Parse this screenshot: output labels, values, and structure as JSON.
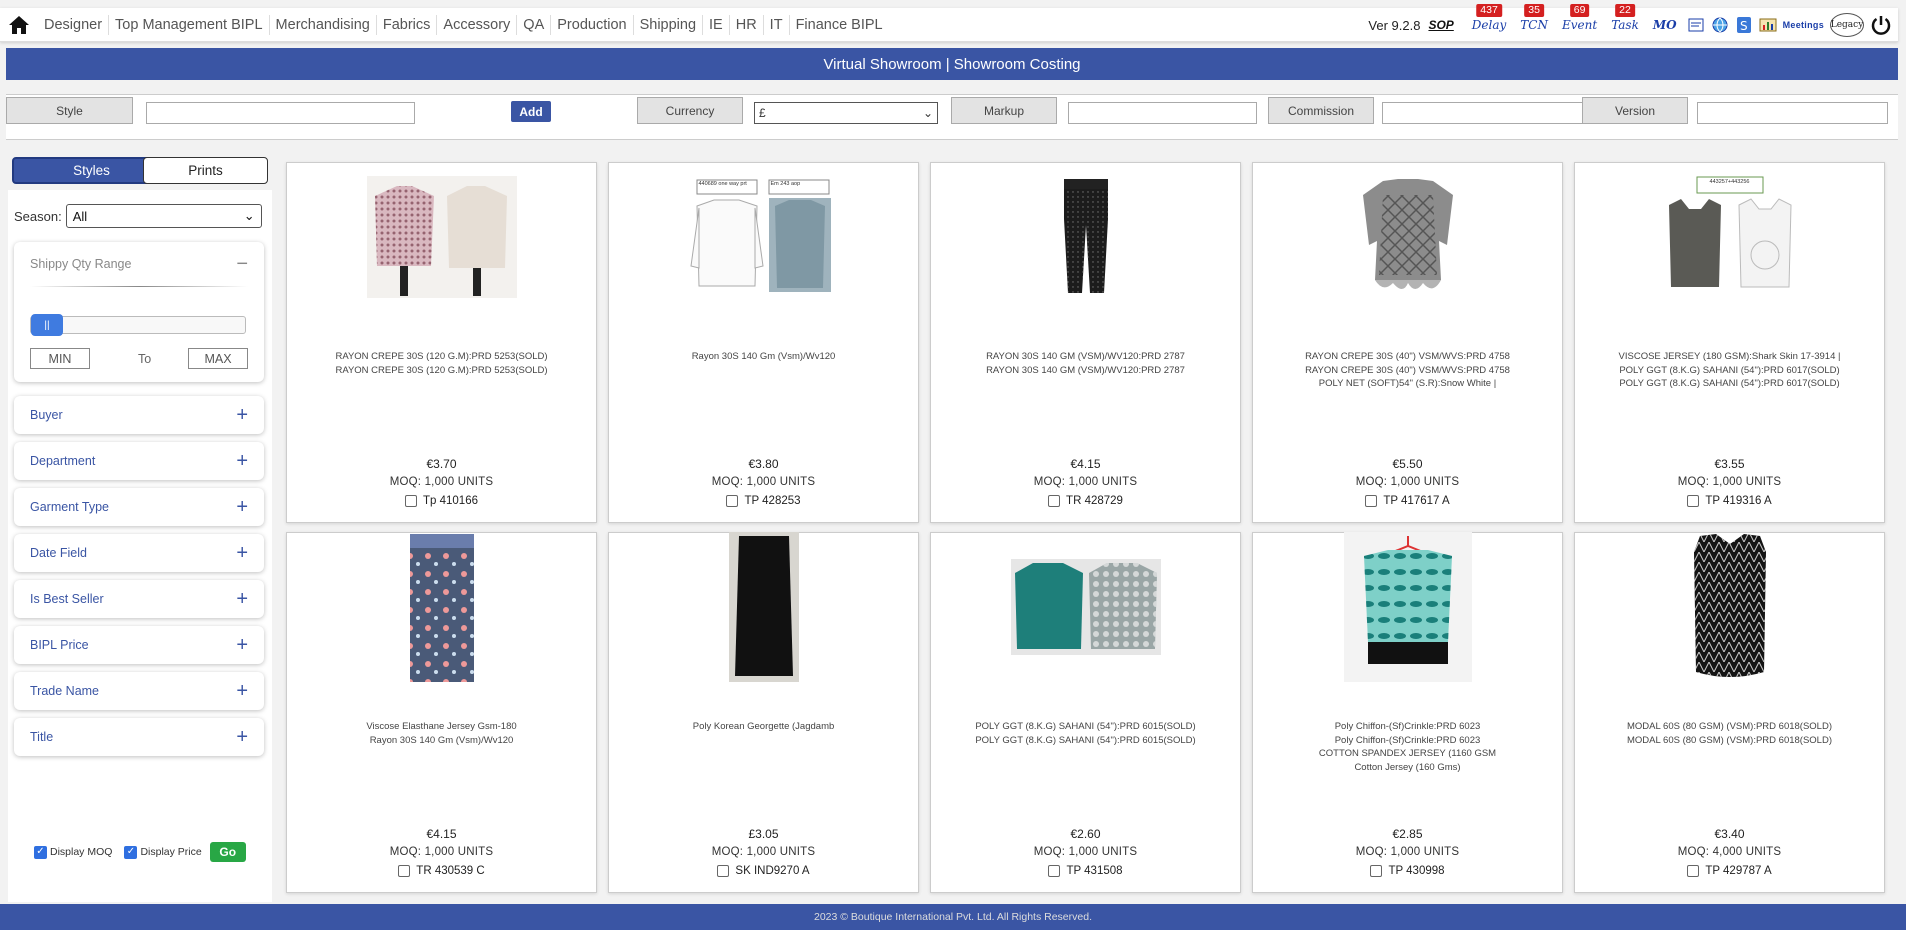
{
  "nav": {
    "menu": [
      "Designer",
      "Top Management BIPL",
      "Merchandising",
      "Fabrics",
      "Accessory",
      "QA",
      "Production",
      "Shipping",
      "IE",
      "HR",
      "IT",
      "Finance BIPL"
    ],
    "version": "Ver 9.2.8",
    "sop": "SOP",
    "delay": {
      "label": "Delay",
      "count": "437"
    },
    "tcn": {
      "label": "TCN",
      "count": "35"
    },
    "event": {
      "label": "Event",
      "count": "69"
    },
    "task": {
      "label": "Task",
      "count": "22"
    },
    "mo": "MO",
    "meetings": "Meetings",
    "legacy": "Legacy"
  },
  "title": "Virtual Showroom | Showroom Costing",
  "filters": {
    "style_label": "Style",
    "style_value": "",
    "add_label": "Add",
    "currency_label": "Currency",
    "currency_value": "£",
    "markup_label": "Markup",
    "markup_value": "",
    "commission_label": "Commission",
    "commission_value": "",
    "version_label": "Version",
    "version_value": ""
  },
  "sidebar": {
    "tab_styles": "Styles",
    "tab_prints": "Prints",
    "season_label": "Season:",
    "season_value": "All",
    "qty_title": "Shippy Qty Range",
    "qty_handle": "||",
    "min_label": "MIN",
    "to_label": "To",
    "max_label": "MAX",
    "panels": [
      "Buyer",
      "Department",
      "Garment Type",
      "Date Field",
      "Is Best Seller",
      "BIPL Price",
      "Trade Name",
      "Title"
    ],
    "display_moq": "Display MOQ",
    "display_price": "Display Price",
    "go": "Go"
  },
  "cards": [
    {
      "desc": [
        "RAYON CREPE 30S (120 G.M):PRD 5253(SOLD)",
        "RAYON CREPE 30S (120 G.M):PRD 5253(SOLD)"
      ],
      "price": "€3.70",
      "moq": "MOQ: 1,000 UNITS",
      "code": "Tp 410166",
      "img": "two-tops"
    },
    {
      "desc": [
        "Rayon 30S 140 Gm (Vsm)/Wv120"
      ],
      "price": "€3.80",
      "moq": "MOQ: 1,000 UNITS",
      "code": "TP 428253",
      "img": "sketch-tops",
      "tags": [
        "440689 one way prt",
        "Em 243 aop"
      ]
    },
    {
      "desc": [
        "RAYON 30S 140 GM (VSM)/WV120:PRD 2787",
        "RAYON 30S 140 GM (VSM)/WV120:PRD 2787"
      ],
      "price": "€4.15",
      "moq": "MOQ: 1,000 UNITS",
      "code": "TR 428729",
      "img": "trousers"
    },
    {
      "desc": [
        "RAYON CREPE 30S (40\") VSM/WVS:PRD 4758",
        "RAYON CREPE 30S (40\") VSM/WVS:PRD 4758",
        "POLY NET (SOFT)54\" (S.R):Snow White |"
      ],
      "price": "€5.50",
      "moq": "MOQ: 1,000 UNITS",
      "code": "TP 417617 A",
      "img": "tunic"
    },
    {
      "desc": [
        "VISCOSE JERSEY (180 GSM):Shark Skin 17-3914 |",
        "POLY GGT (8.K.G) SAHANI (54\"):PRD 6017(SOLD)",
        "POLY GGT (8.K.G) SAHANI (54\"):PRD 6017(SOLD)"
      ],
      "price": "€3.55",
      "moq": "MOQ: 1,000 UNITS",
      "code": "TP 419316 A",
      "img": "vests",
      "tags": [
        "443257+443256"
      ]
    },
    {
      "desc": [
        "Viscose Elasthane Jersey Gsm-180",
        "Rayon 30S 140 Gm (Vsm)/Wv120"
      ],
      "price": "€4.15",
      "moq": "MOQ: 1,000 UNITS",
      "code": "TR 430539 C",
      "img": "maxi-skirt"
    },
    {
      "desc": [
        "Poly Korean Georgette (Jagdamb"
      ],
      "price": "£3.05",
      "moq": "MOQ: 1,000 UNITS",
      "code": "SK IND9270 A",
      "img": "black-skirt"
    },
    {
      "desc": [
        "POLY GGT (8.K.G) SAHANI (54\"):PRD 6015(SOLD)",
        "POLY GGT (8.K.G) SAHANI (54\"):PRD 6015(SOLD)"
      ],
      "price": "€2.60",
      "moq": "MOQ: 1,000 UNITS",
      "code": "TP 431508",
      "img": "two-blouses"
    },
    {
      "desc": [
        "Poly Chiffon-(Sf)Crinkle:PRD 6023",
        "Poly Chiffon-(Sf)Crinkle:PRD 6023",
        "COTTON SPANDEX JERSEY (1160 GSM",
        "Cotton Jersey (160 Gms)"
      ],
      "price": "€2.85",
      "moq": "MOQ: 1,000 UNITS",
      "code": "TP 430998",
      "img": "hanger-top"
    },
    {
      "desc": [
        "MODAL 60S (80 GSM) (VSM):PRD 6018(SOLD)",
        "MODAL 60S (80 GSM) (VSM):PRD 6018(SOLD)"
      ],
      "price": "€3.40",
      "moq": "MOQ: 4,000 UNITS",
      "code": "TP 429787 A",
      "img": "black-top"
    }
  ],
  "footer": "2023 © Boutique International Pvt. Ltd. All Rights Reserved.",
  "colors": {
    "primary": "#3a55a4",
    "badge": "#d42020",
    "go": "#28a745"
  }
}
